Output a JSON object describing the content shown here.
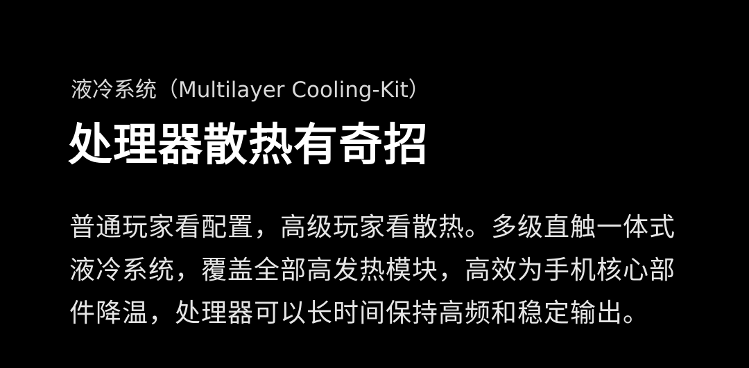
{
  "colors": {
    "background": "#000000",
    "headline": "#ffffff",
    "subtitle": "#d9d9d9",
    "body": "#e6e6e6"
  },
  "section": {
    "subtitle": "液冷系统（Multilayer Cooling-Kit）",
    "headline": "处理器散热有奇招",
    "body_lines": [
      "普通玩家看配置，高级玩家看散热。多级直触一体式",
      "液冷系统，覆盖全部高发热模块，高效为手机核心部",
      "件降温，处理器可以长时间保持高频和稳定输出。"
    ]
  }
}
